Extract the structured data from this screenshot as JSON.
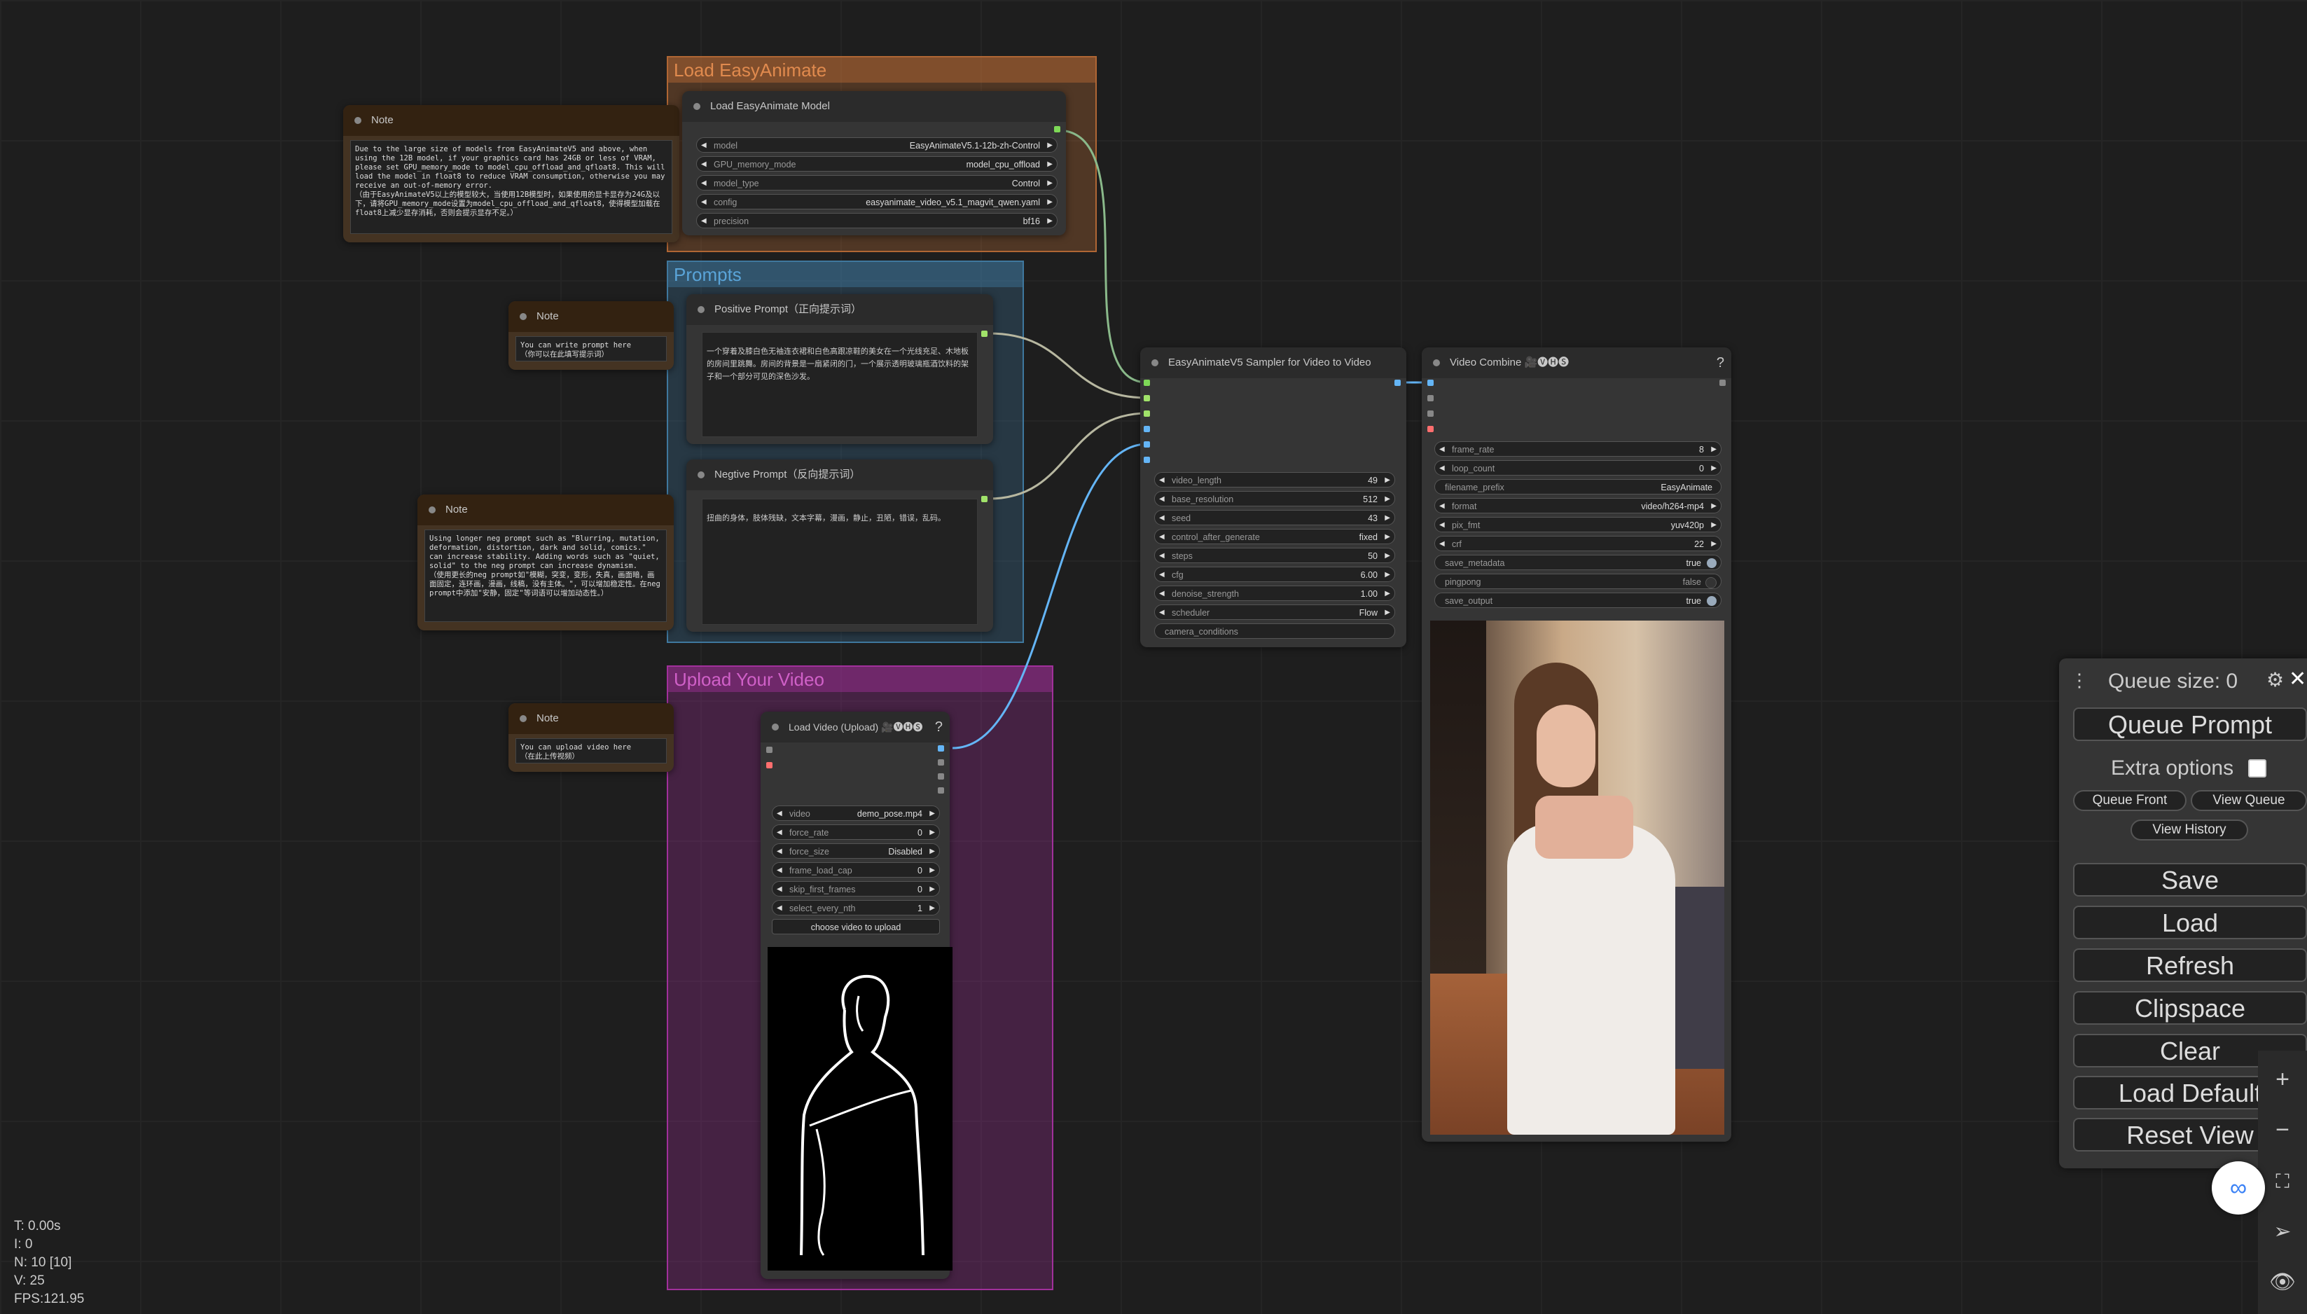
{
  "groups": {
    "load": {
      "title": "Load EasyAnimate"
    },
    "prompts": {
      "title": "Prompts"
    },
    "upload": {
      "title": "Upload Your Video"
    }
  },
  "notes": {
    "note1": {
      "title": "Note",
      "text": "Due to the large size of models from EasyAnimateV5 and above, when using the 12B model, if your graphics card has 24GB or less of VRAM, please set GPU_memory_mode to model_cpu_offload_and_qfloat8. This will load the model in float8 to reduce VRAM consumption, otherwise you may receive an out-of-memory error.\n（由于EasyAnimateV5以上的模型较大，当使用12B模型时，如果使用的显卡显存为24G及以下，请将GPU_memory_mode设置为model_cpu_offload_and_qfloat8，使得模型加载在float8上减少显存消耗，否则会提示显存不足。）"
    },
    "note2": {
      "title": "Note",
      "text": "You can write prompt here\n（你可以在此填写提示词）"
    },
    "note3": {
      "title": "Note",
      "text": "Using longer neg prompt such as \"Blurring, mutation, deformation, distortion, dark and solid, comics.\" can increase stability. Adding words such as \"quiet, solid\" to the neg prompt can increase dynamism.\n（使用更长的neg prompt如\"模糊，突变，变形，失真，画面暗，画面固定，连环画，漫画，线稿，没有主体。\"，可以增加稳定性。在neg prompt中添加\"安静，固定\"等词语可以增加动态性。）"
    },
    "note4": {
      "title": "Note",
      "text": "You can upload video here\n（在此上传视频）"
    }
  },
  "model_node": {
    "title": "Load EasyAnimate Model",
    "widgets": [
      {
        "label": "model",
        "value": "EasyAnimateV5.1-12b-zh-Control"
      },
      {
        "label": "GPU_memory_mode",
        "value": "model_cpu_offload"
      },
      {
        "label": "model_type",
        "value": "Control"
      },
      {
        "label": "config",
        "value": "easyanimate_video_v5.1_magvit_qwen.yaml"
      },
      {
        "label": "precision",
        "value": "bf16"
      }
    ]
  },
  "positive_prompt": {
    "title": "Positive Prompt（正向提示词）",
    "text": "一个穿着及膝白色无袖连衣裙和白色高跟凉鞋的美女在一个光线充足、木地板的房间里跳舞。房间的背景是一扇紧闭的门，一个展示透明玻璃瓶酒饮料的架子和一个部分可见的深色沙发。"
  },
  "negative_prompt": {
    "title": "Negtive Prompt（反向提示词）",
    "text": "扭曲的身体，肢体残缺，文本字幕，漫画，静止，丑陋，错误，乱码。"
  },
  "sampler": {
    "title": "EasyAnimateV5 Sampler for Video to Video",
    "widgets": [
      {
        "label": "video_length",
        "value": "49"
      },
      {
        "label": "base_resolution",
        "value": "512"
      },
      {
        "label": "seed",
        "value": "43"
      },
      {
        "label": "control_after_generate",
        "value": "fixed"
      },
      {
        "label": "steps",
        "value": "50"
      },
      {
        "label": "cfg",
        "value": "6.00"
      },
      {
        "label": "denoise_strength",
        "value": "1.00"
      },
      {
        "label": "scheduler",
        "value": "Flow"
      }
    ],
    "input_widget": "camera_conditions"
  },
  "video_combine": {
    "title": "Video Combine 🎥🅥🅗🅢",
    "help": "?",
    "widgets": [
      {
        "label": "frame_rate",
        "value": "8"
      },
      {
        "label": "loop_count",
        "value": "0"
      },
      {
        "label": "filename_prefix",
        "value": "EasyAnimate"
      },
      {
        "label": "format",
        "value": "video/h264-mp4"
      },
      {
        "label": "pix_fmt",
        "value": "yuv420p"
      },
      {
        "label": "crf",
        "value": "22"
      }
    ],
    "toggles": [
      {
        "label": "save_metadata",
        "value": "true"
      },
      {
        "label": "pingpong",
        "value": "false"
      },
      {
        "label": "save_output",
        "value": "true"
      }
    ]
  },
  "load_video": {
    "title": "Load Video (Upload) 🎥🅥🅗🅢",
    "help": "?",
    "widgets": [
      {
        "label": "video",
        "value": "demo_pose.mp4"
      },
      {
        "label": "force_rate",
        "value": "0"
      },
      {
        "label": "force_size",
        "value": "Disabled"
      },
      {
        "label": "frame_load_cap",
        "value": "0"
      },
      {
        "label": "skip_first_frames",
        "value": "0"
      },
      {
        "label": "select_every_nth",
        "value": "1"
      }
    ],
    "upload_button": "choose video to upload"
  },
  "queue_panel": {
    "queue_size": "Queue size: 0",
    "queue_prompt": "Queue Prompt",
    "extra_options": "Extra options",
    "queue_front": "Queue Front",
    "view_queue": "View Queue",
    "view_history": "View History",
    "save": "Save",
    "load": "Load",
    "refresh": "Refresh",
    "clipspace": "Clipspace",
    "clear": "Clear",
    "load_default": "Load Default",
    "reset_view": "Reset View"
  },
  "stats": {
    "t": "T: 0.00s",
    "i": "I: 0",
    "n": "N: 10 [10]",
    "v": "V: 25",
    "fps": "FPS:121.95"
  },
  "colors": {
    "load_group": "#b06634",
    "prompts_group": "#3f789e",
    "upload_group": "#a1309b",
    "note": "#432",
    "link_model": "#8ab98a",
    "link_image": "#64b5f6"
  }
}
